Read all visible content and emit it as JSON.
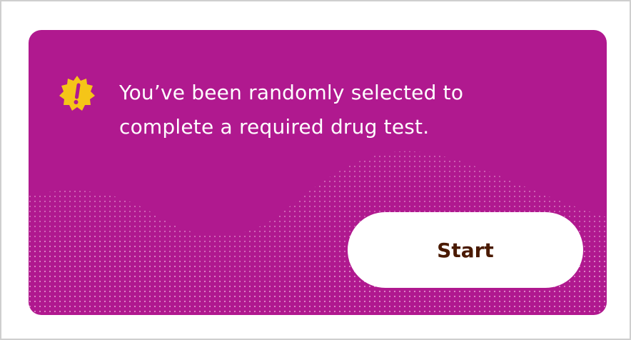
{
  "card": {
    "message": "You’ve been randomly selected to complete a required drug test.",
    "icon": "alert-badge-icon",
    "start_label": "Start"
  },
  "colors": {
    "card_background": "#b0198f",
    "badge": "#f5c518",
    "badge_mark": "#b0198f",
    "button_background": "#ffffff",
    "button_text": "#4a1a00",
    "message_text": "#ffffff"
  }
}
